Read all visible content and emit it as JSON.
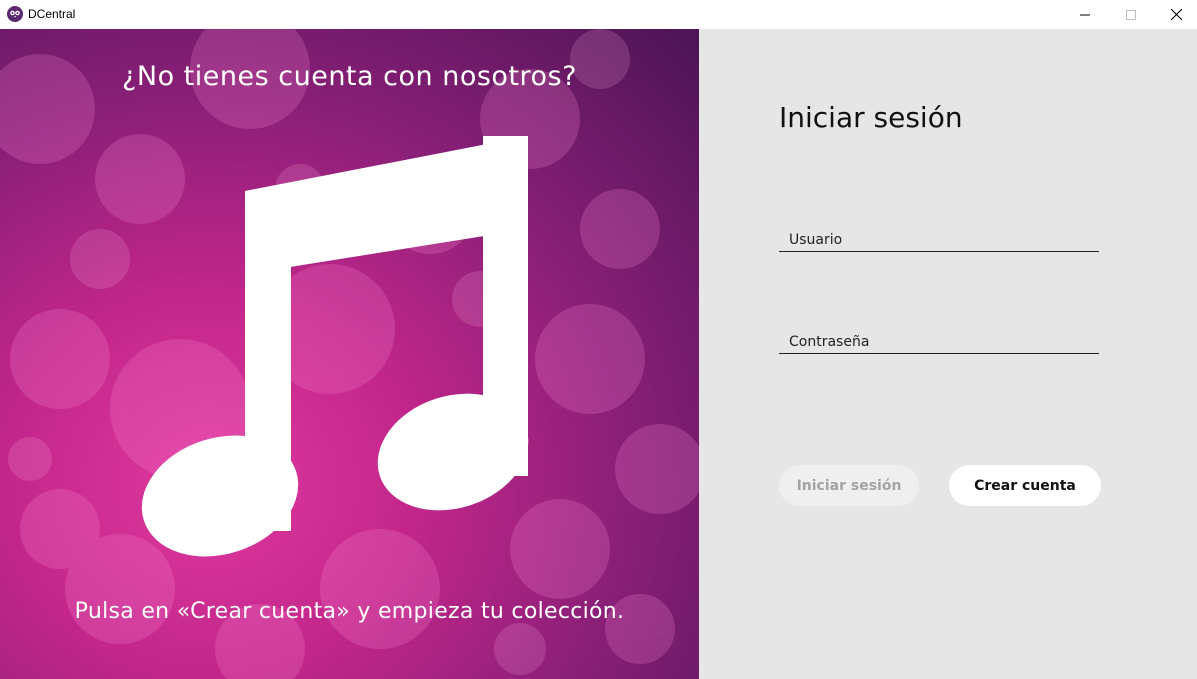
{
  "window": {
    "title": "DCentral",
    "icon": "owl-app-icon",
    "controls": [
      "minimize-icon",
      "maximize-icon",
      "close-icon"
    ]
  },
  "signup_promo": {
    "heading": "¿No tienes cuenta con nosotros?",
    "footer": "Pulsa en «Crear cuenta» y empieza tu colección.",
    "image": "music-note-icon",
    "gradient_colors": [
      "#e0399f",
      "#c2268a",
      "#8a1f78",
      "#4b1454"
    ]
  },
  "login": {
    "title": "Iniciar sesión",
    "username_placeholder": "Usuario",
    "password_placeholder": "Contraseña",
    "login_button": "Iniciar sesión",
    "create_button": "Crear cuenta"
  },
  "colors": {
    "panel_bg": "#e6e6e6",
    "login_button_bg": "#efefef",
    "login_button_text": "#a3a3a3",
    "create_button_bg": "#ffffff"
  }
}
